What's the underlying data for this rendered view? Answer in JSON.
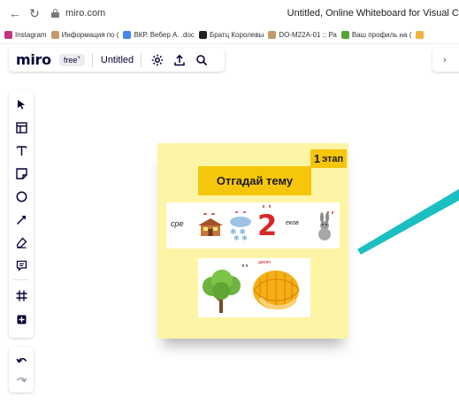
{
  "browser": {
    "url": "miro.com",
    "page_title": "Untitled, Online Whiteboard for Visual Co",
    "bookmarks": [
      {
        "label": "Instagram",
        "color": "#c13584"
      },
      {
        "label": "Информация по (",
        "color": "#c49a6c"
      },
      {
        "label": "ВКР. Вебер А. .doc",
        "color": "#4285f4"
      },
      {
        "label": "Братц  Королевы",
        "color": "#222222"
      },
      {
        "label": "DO-M22A-01 :: Ра",
        "color": "#c49a6c"
      },
      {
        "label": "Ваш профиль на (",
        "color": "#52a535"
      },
      {
        "label": "",
        "color": "#f2b33d"
      }
    ]
  },
  "toolbar_top": {
    "logo": "miro",
    "plan_badge": "free",
    "plan_badge_sup": "+",
    "board_name": "Untitled",
    "icons": [
      "settings-icon",
      "upload-icon",
      "search-icon"
    ]
  },
  "right_panel": {
    "chevron": "›"
  },
  "left_toolbar": {
    "tools": [
      "select-icon",
      "templates-icon",
      "text-icon",
      "sticky-note-icon",
      "shape-icon",
      "pen-arrow-icon",
      "eraser-icon",
      "comment-icon",
      "frame-icon",
      "add-more-icon"
    ],
    "history": [
      "undo-icon",
      "redo-icon"
    ]
  },
  "sticky": {
    "stage_number": "1",
    "stage_label": "этап",
    "title": "Отгадай тему",
    "rebus_word_1": "сре",
    "rebus_number": "2",
    "rebus_word_2": "еков",
    "rebus_caption_2": "диния",
    "colors": {
      "note": "#fef4a5",
      "accent": "#f6c60c",
      "number": "#d62828",
      "connector": "#1bbfc1"
    }
  }
}
